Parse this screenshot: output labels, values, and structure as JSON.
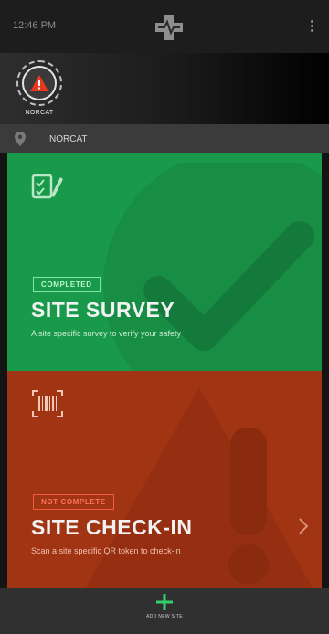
{
  "status_bar": {
    "time": "12:46 PM"
  },
  "site_strip": {
    "avatar_label": "NORCAT"
  },
  "location": {
    "name": "NORCAT"
  },
  "cards": {
    "survey": {
      "status": "COMPLETED",
      "title": "SITE SURVEY",
      "description": "A site specific survey to verify your safety",
      "color": "#199a4b"
    },
    "checkin": {
      "status": "NOT COMPLETE",
      "title": "SITE CHECK-IN",
      "description": "Scan a site specific QR token to check-in",
      "color": "#a13413"
    }
  },
  "bottom_bar": {
    "add_label": "ADD NEW SITE",
    "accent": "#35d06a"
  },
  "icons": [
    "app-logo-icon",
    "more-vertical-icon",
    "warning-icon",
    "location-pin-icon",
    "checklist-icon",
    "barcode-scan-icon",
    "chevron-right-icon",
    "plus-icon"
  ]
}
